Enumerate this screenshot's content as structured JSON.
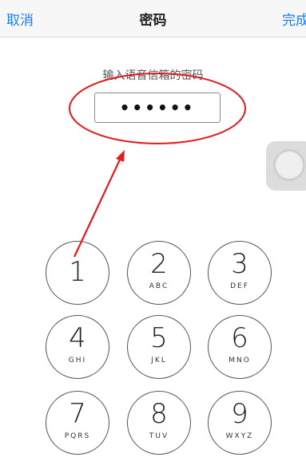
{
  "navbar": {
    "cancel_label": "取消",
    "title": "密码",
    "done_label": "完成"
  },
  "prompt": "输入语音信箱的密码",
  "password_value": "••••••",
  "keypad": [
    {
      "digit": "1",
      "letters": ""
    },
    {
      "digit": "2",
      "letters": "ABC"
    },
    {
      "digit": "3",
      "letters": "DEF"
    },
    {
      "digit": "4",
      "letters": "GHI"
    },
    {
      "digit": "5",
      "letters": "JKL"
    },
    {
      "digit": "6",
      "letters": "MNO"
    },
    {
      "digit": "7",
      "letters": "PQRS"
    },
    {
      "digit": "8",
      "letters": "TUV"
    },
    {
      "digit": "9",
      "letters": "WXYZ"
    }
  ],
  "colors": {
    "link_blue": "#1a7cf5",
    "annotation_red": "#e31b1b"
  },
  "icons": [
    "assistive-touch-icon"
  ]
}
